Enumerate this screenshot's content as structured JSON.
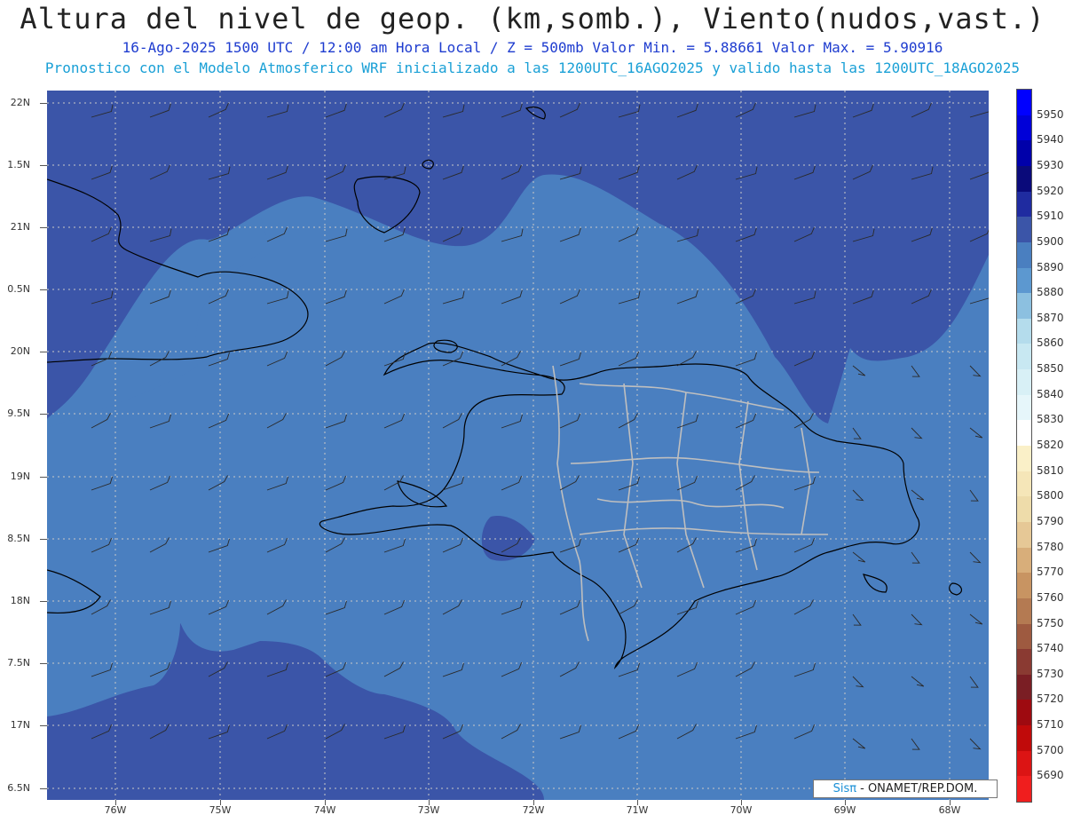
{
  "header": {
    "title": "Altura del nivel de geop. (km,somb.), Viento(nudos,vast.)",
    "line1": "16-Ago-2025  1500 UTC / 12:00 am Hora Local / Z = 500mb    Valor Min. = 5.88661  Valor Max. = 5.90916",
    "line2": "Pronostico con el Modelo Atmosferico WRF inicializado a las 1200UTC_16AGO2025 y valido hasta las  1200UTC_18AGO2025"
  },
  "axes": {
    "lat_labels": [
      "22N",
      "1.5N",
      "21N",
      "0.5N",
      "20N",
      "9.5N",
      "19N",
      "8.5N",
      "18N",
      "7.5N",
      "17N",
      "6.5N"
    ],
    "lon_labels": [
      "76W",
      "75W",
      "74W",
      "73W",
      "72W",
      "71W",
      "70W",
      "69W",
      "68W"
    ]
  },
  "colorbar": {
    "labels": [
      "5950",
      "5940",
      "5930",
      "5920",
      "5910",
      "5900",
      "5890",
      "5880",
      "5870",
      "5860",
      "5850",
      "5840",
      "5830",
      "5820",
      "5810",
      "5800",
      "5790",
      "5780",
      "5770",
      "5760",
      "5750",
      "5740",
      "5730",
      "5720",
      "5710",
      "5700",
      "5690"
    ],
    "colors": [
      "#0000ff",
      "#0000d8",
      "#0000aa",
      "#0a0a7a",
      "#1f2ba0",
      "#3b55a8",
      "#4a7fc0",
      "#5c98d0",
      "#8cc0e0",
      "#b4dcec",
      "#c8e8f2",
      "#d8f0f6",
      "#e6f6fa",
      "#ffffff",
      "#faf0c8",
      "#f5e6b8",
      "#eedcaa",
      "#e6c896",
      "#d8ae7a",
      "#c89462",
      "#b47a52",
      "#9e5a40",
      "#8a3a32",
      "#7a1e24",
      "#9e0a10",
      "#c00a0a",
      "#dc1414",
      "#f01e1e"
    ],
    "shade_colors": {
      "deep": "#3b55a8",
      "mid": "#4a7fc0"
    }
  },
  "credit": {
    "logo": "Sisπ",
    "text": "- ONAMET/REP.DOM."
  }
}
